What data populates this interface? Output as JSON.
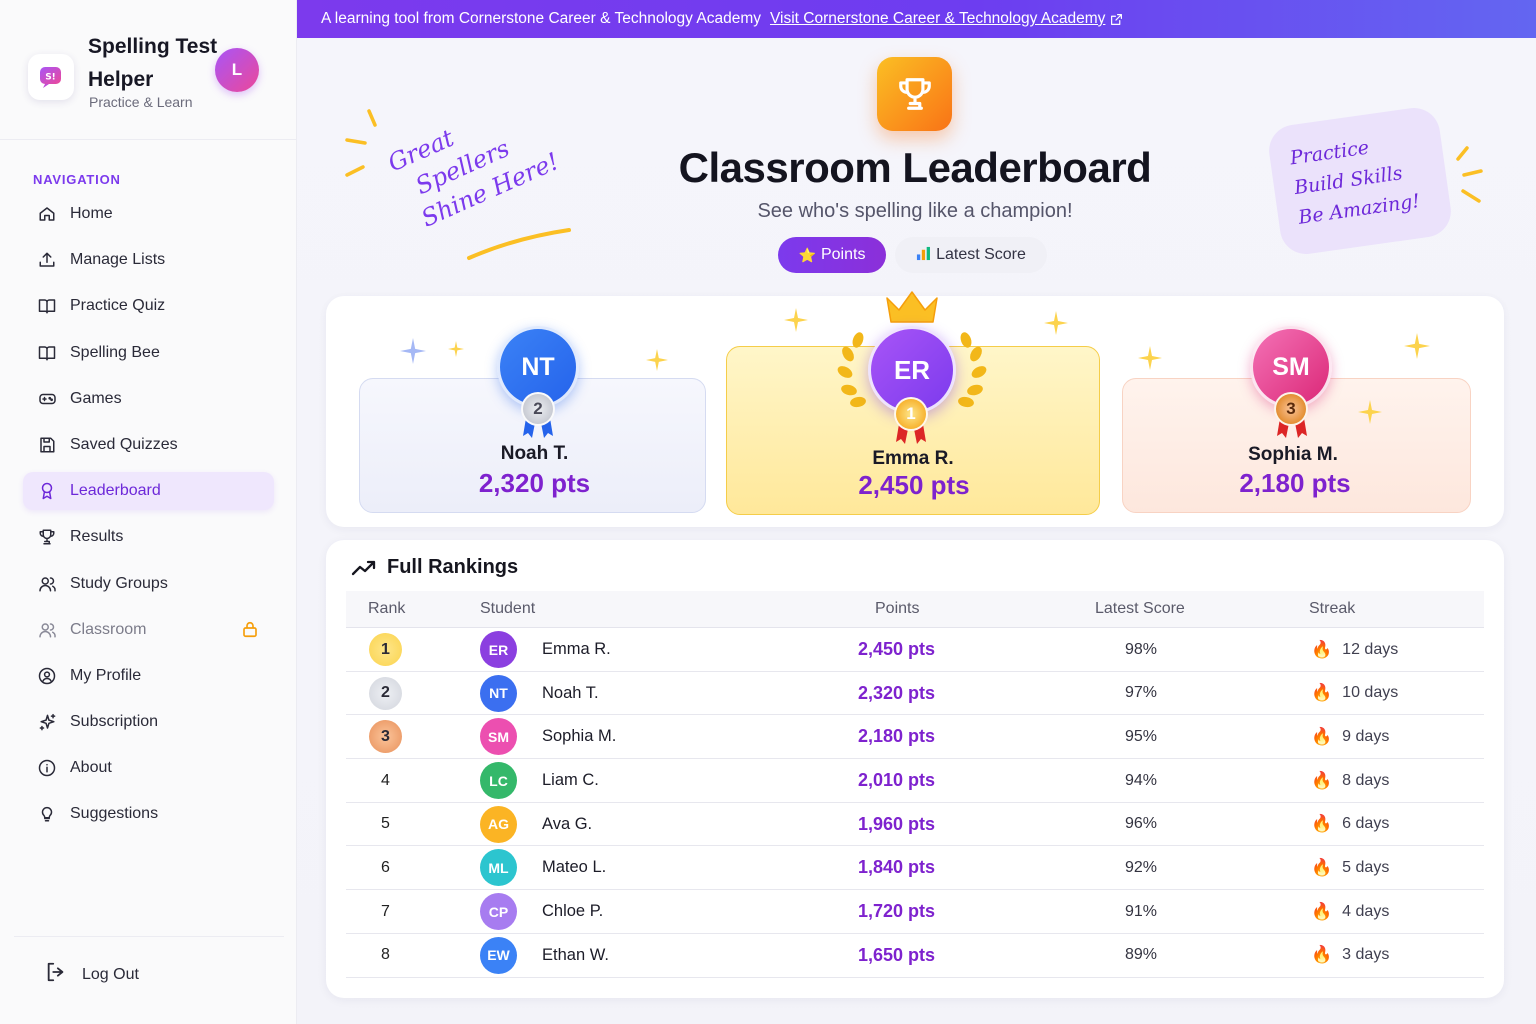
{
  "banner": {
    "text": "A learning tool from Cornerstone Career & Technology Academy",
    "link": "Visit Cornerstone Career & Technology Academy"
  },
  "brand": {
    "title": "Spelling Test Helper",
    "subtitle": "Practice & Learn",
    "avatar_initial": "L"
  },
  "sidebar": {
    "heading": "NAVIGATION",
    "items": [
      {
        "label": "Home",
        "icon": "home-icon"
      },
      {
        "label": "Manage Lists",
        "icon": "upload-icon"
      },
      {
        "label": "Practice Quiz",
        "icon": "book-icon"
      },
      {
        "label": "Spelling Bee",
        "icon": "book-icon"
      },
      {
        "label": "Games",
        "icon": "gamepad-icon"
      },
      {
        "label": "Saved Quizzes",
        "icon": "save-icon"
      },
      {
        "label": "Leaderboard",
        "icon": "award-icon",
        "active": true
      },
      {
        "label": "Results",
        "icon": "trophy-icon"
      },
      {
        "label": "Study Groups",
        "icon": "users-icon"
      },
      {
        "label": "Classroom",
        "icon": "users-icon",
        "locked": true
      },
      {
        "label": "My Profile",
        "icon": "user-circle-icon"
      },
      {
        "label": "Subscription",
        "icon": "sparkles-icon"
      },
      {
        "label": "About",
        "icon": "info-icon"
      },
      {
        "label": "Suggestions",
        "icon": "lightbulb-icon"
      }
    ],
    "logout": "Log Out"
  },
  "hero": {
    "title": "Classroom Leaderboard",
    "subtitle": "See who's spelling like a champion!",
    "toggle_points": "Points",
    "toggle_latest": "Latest Score",
    "note_left": [
      "Great",
      "Spellers",
      "Shine Here!"
    ],
    "note_right": [
      "Practice",
      "Build Skills",
      "Be Amazing!"
    ]
  },
  "podium": {
    "first": {
      "initials": "ER",
      "name": "Emma R.",
      "points": "2,450 pts",
      "medal": "1"
    },
    "second": {
      "initials": "NT",
      "name": "Noah T.",
      "points": "2,320 pts",
      "medal": "2"
    },
    "third": {
      "initials": "SM",
      "name": "Sophia M.",
      "points": "2,180 pts",
      "medal": "3"
    }
  },
  "rankings": {
    "title": "Full Rankings",
    "columns": [
      "Rank",
      "Student",
      "Points",
      "Latest Score",
      "Streak"
    ],
    "rows": [
      {
        "rank": "1",
        "initials": "ER",
        "name": "Emma R.",
        "points": "2,450 pts",
        "score": "98%",
        "streak": "12 days",
        "color": "#8b3fe0"
      },
      {
        "rank": "2",
        "initials": "NT",
        "name": "Noah T.",
        "points": "2,320 pts",
        "score": "97%",
        "streak": "10 days",
        "color": "#3b6ff0"
      },
      {
        "rank": "3",
        "initials": "SM",
        "name": "Sophia M.",
        "points": "2,180 pts",
        "score": "95%",
        "streak": "9 days",
        "color": "#ec4fb0"
      },
      {
        "rank": "4",
        "initials": "LC",
        "name": "Liam C.",
        "points": "2,010 pts",
        "score": "94%",
        "streak": "8 days",
        "color": "#34b86a"
      },
      {
        "rank": "5",
        "initials": "AG",
        "name": "Ava G.",
        "points": "1,960 pts",
        "score": "96%",
        "streak": "6 days",
        "color": "#fbb424"
      },
      {
        "rank": "6",
        "initials": "ML",
        "name": "Mateo L.",
        "points": "1,840 pts",
        "score": "92%",
        "streak": "5 days",
        "color": "#2cc5cf"
      },
      {
        "rank": "7",
        "initials": "CP",
        "name": "Chloe P.",
        "points": "1,720 pts",
        "score": "91%",
        "streak": "4 days",
        "color": "#a77cf0"
      },
      {
        "rank": "8",
        "initials": "EW",
        "name": "Ethan W.",
        "points": "1,650 pts",
        "score": "89%",
        "streak": "3 days",
        "color": "#3b82f6"
      }
    ]
  },
  "colors": {
    "accent": "#7c3aed",
    "points": "#7e22ce",
    "gold": "#fcd34d",
    "silver": "#d4d6dd",
    "bronze": "#f0a070"
  }
}
